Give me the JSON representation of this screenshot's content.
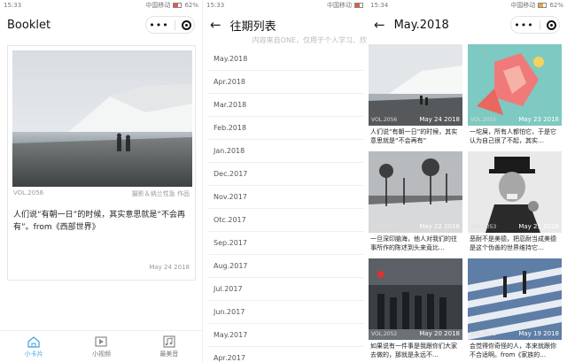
{
  "status": {
    "p1_time": "15:33",
    "p2_time": "15:33",
    "p3_time": "15:34",
    "carrier": "中国移动",
    "battery": "62%"
  },
  "booklet": {
    "title": "Booklet",
    "card": {
      "vol": "VOL.2056",
      "credit": "摄影＆纳兰性急 作品",
      "quote": "人们说“有朝一日”的时候，其实意思就是“不会再有”。from《西部世界》",
      "date": "May 24 2018"
    },
    "tabs": [
      {
        "label": "小卡片",
        "icon": "card-icon"
      },
      {
        "label": "小视频",
        "icon": "video-icon"
      },
      {
        "label": "最美音",
        "icon": "music-icon"
      }
    ]
  },
  "archive": {
    "title": "往期列表",
    "note": "内容来自ONE，仅用于个人学习、欣",
    "months": [
      "May.2018",
      "Apr.2018",
      "Mar.2018",
      "Feb.2018",
      "Jan.2018",
      "Dec.2017",
      "Nov.2017",
      "Otc.2017",
      "Sep.2017",
      "Aug.2017",
      "Jul.2017",
      "Jun.2017",
      "May.2017",
      "Apr.2017"
    ]
  },
  "month": {
    "title": "May.2018",
    "items": [
      {
        "vol": "VOL.2056",
        "date": "May 24 2018",
        "text": "人们说“有朝一日”的时候，其实意思就是“不会再有”"
      },
      {
        "vol": "VOL.2055",
        "date": "May 23 2018",
        "text": "一坨屎，所有人都怕它，于是它认为自己很了不起，其实…"
      },
      {
        "vol": "VOL.2054",
        "date": "May 22 2018",
        "text": "一旦深印脑海，他人对我们的往事所作的陈述到头来竟比…"
      },
      {
        "vol": "VOL.2053",
        "date": "May 21 2018",
        "text": "恶耐不是美德，把忍耐当成美德是这个伪善的世界维持它…"
      },
      {
        "vol": "VOL.2052",
        "date": "May 20 2018",
        "text": "如果说有一件事是我跟你们大家去做的，那就是永远不…"
      },
      {
        "vol": "VOL.2051",
        "date": "May 19 2018",
        "text": "会觉得你奇怪的人，本来就跟你不合适啊。from《家族的…"
      }
    ]
  }
}
